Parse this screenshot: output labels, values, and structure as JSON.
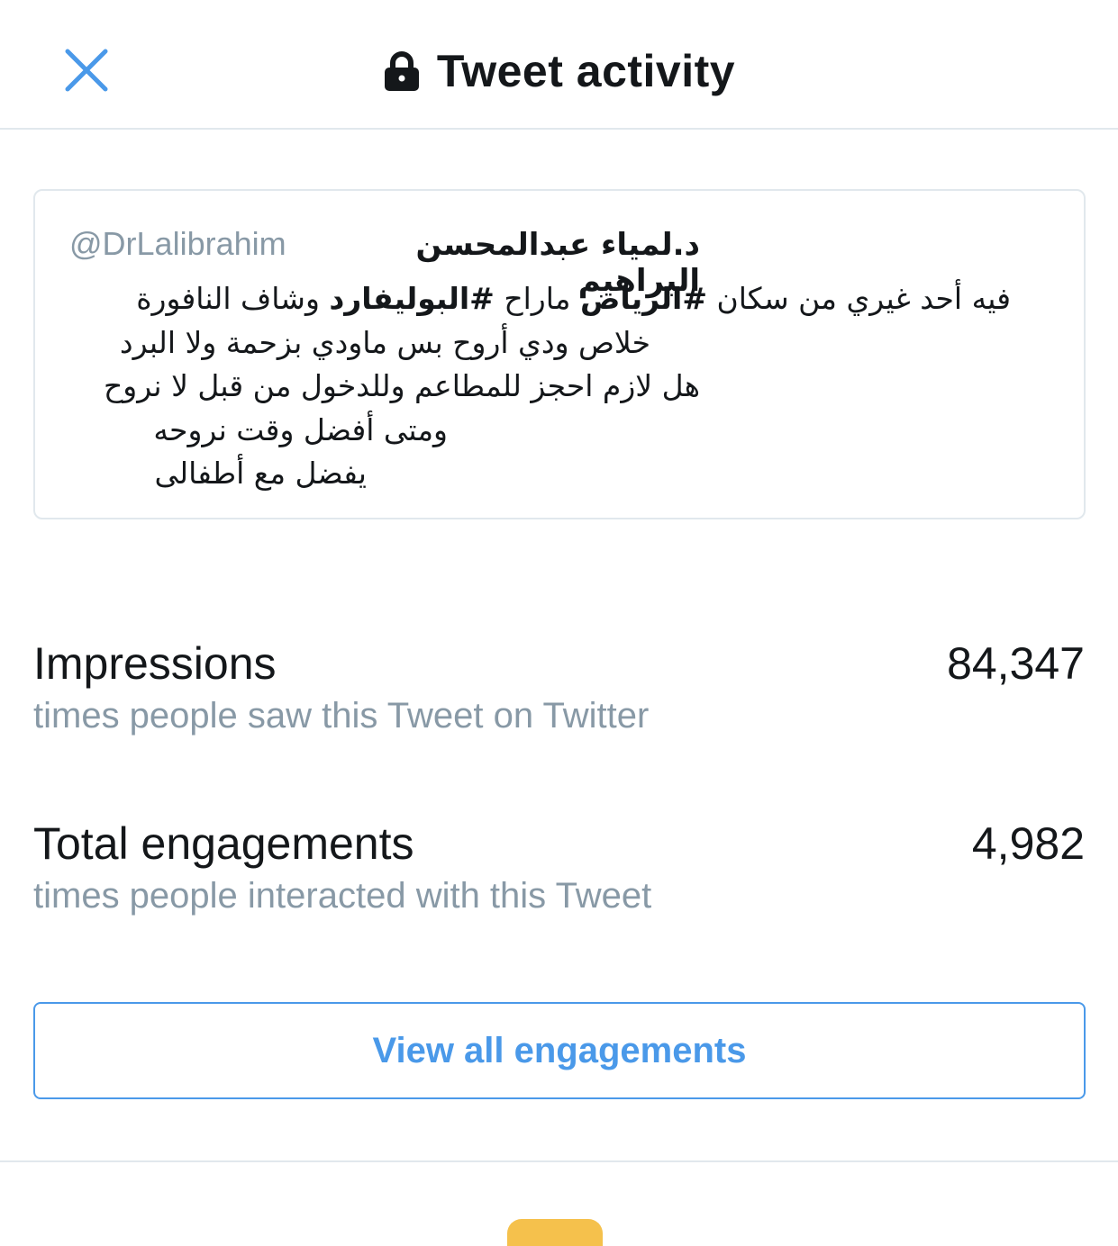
{
  "header": {
    "title": "Tweet activity",
    "close_icon": "close-icon",
    "lock_icon": "lock-icon",
    "accent_color": "#4a99e9"
  },
  "tweet": {
    "author_name": "د.لمياء عبدالمحسن البراهيم",
    "author_handle": "@DrLalibrahim",
    "lines": [
      [
        "فيه أحد غيري من سكان ",
        "#الرياض",
        " ماراح ",
        "#البوليفارد",
        "  وشاف النافورة"
      ],
      "خلاص ودي أروح بس ماودي بزحمة ولا البرد",
      "هل لازم احجز للمطاعم وللدخول  من قبل لا نروح",
      "ومتى أفضل وقت نروحه",
      "يفضل مع أطفالى"
    ]
  },
  "metrics": {
    "impressions": {
      "label": "Impressions",
      "subtitle": "times people saw this Tweet on Twitter",
      "value": "84,347"
    },
    "engagements": {
      "label": "Total engagements",
      "subtitle": "times people interacted with this Tweet",
      "value": "4,982"
    }
  },
  "actions": {
    "view_all_label": "View all engagements"
  }
}
